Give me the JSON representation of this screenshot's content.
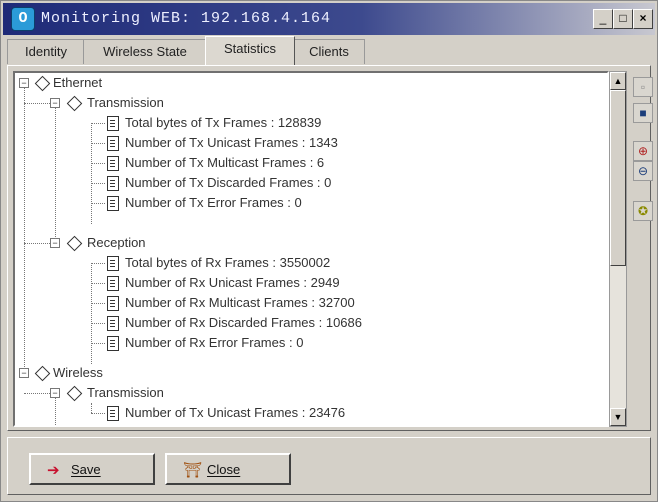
{
  "window": {
    "title": "Monitoring WEB: 192.168.4.164",
    "icon_glyph": "O",
    "controls": {
      "minimize": "_",
      "maximize": "□",
      "close": "×"
    }
  },
  "tabs": [
    {
      "label": "Identity"
    },
    {
      "label": "Wireless State"
    },
    {
      "label": "Statistics",
      "active": true
    },
    {
      "label": "Clients"
    }
  ],
  "tree": {
    "ethernet": "Ethernet",
    "eth_tx": "Transmission",
    "eth_tx_items": [
      "Total bytes of Tx Frames : 128839",
      "Number of Tx Unicast Frames : 1343",
      "Number of Tx Multicast Frames : 6",
      "Number of Tx Discarded Frames : 0",
      "Number of Tx Error Frames : 0"
    ],
    "eth_rx": "Reception",
    "eth_rx_items": [
      "Total bytes of Rx Frames : 3550002",
      "Number of Rx Unicast Frames : 2949",
      "Number of Rx Multicast Frames : 32700",
      "Number of Rx Discarded Frames : 10686",
      "Number of Rx Error Frames : 0"
    ],
    "wireless": "Wireless",
    "wl_tx": "Transmission",
    "wl_tx_items": [
      "Number of Tx Unicast Frames : 23476"
    ]
  },
  "toolbar_icons": [
    "window-icon",
    "stop-icon",
    "zoom-in-icon",
    "zoom-out-icon",
    "bulb-icon"
  ],
  "buttons": {
    "save": "Save",
    "close": "Close"
  }
}
